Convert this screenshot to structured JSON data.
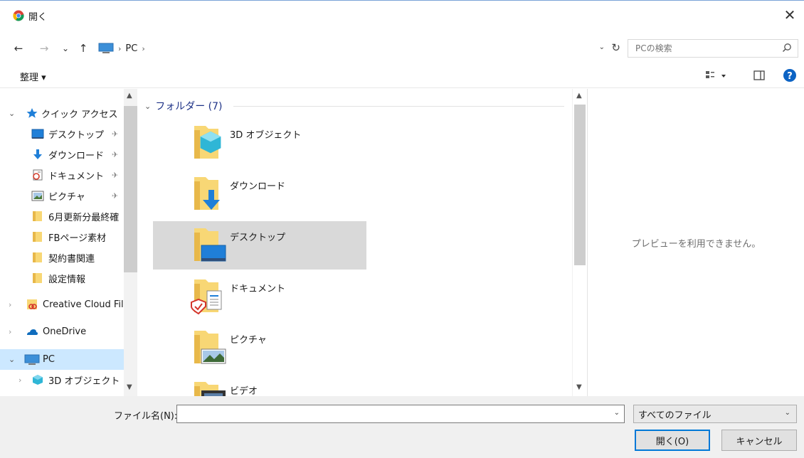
{
  "window": {
    "title": "開く",
    "close_glyph": "✕"
  },
  "nav": {
    "back": "←",
    "forward": "→",
    "recent": "⌄",
    "up": "↑",
    "address": {
      "segments": [
        "PC"
      ],
      "dropdown": "⌄",
      "refresh": "↻"
    },
    "search": {
      "placeholder": "PCの検索"
    }
  },
  "toolbar": {
    "organize": "整理 ▾"
  },
  "sidebar": {
    "items": [
      {
        "label": "クイック アクセス",
        "chevron": "⌄",
        "icon": "star-icon"
      },
      {
        "label": "デスクトップ",
        "icon": "desktop-icon",
        "pinned": true
      },
      {
        "label": "ダウンロード",
        "icon": "download-icon",
        "pinned": true
      },
      {
        "label": "ドキュメント",
        "icon": "document-icon",
        "pinned": true
      },
      {
        "label": "ピクチャ",
        "icon": "picture-icon",
        "pinned": true
      },
      {
        "label": "6月更新分最終確",
        "icon": "folder-icon"
      },
      {
        "label": "FBページ素材",
        "icon": "folder-icon"
      },
      {
        "label": "契約書関連",
        "icon": "folder-icon"
      },
      {
        "label": "設定情報",
        "icon": "folder-icon"
      },
      {
        "label": "Creative Cloud Files",
        "chevron": "›",
        "icon": "creative-cloud-icon"
      },
      {
        "label": "OneDrive",
        "chevron": "›",
        "icon": "onedrive-icon"
      },
      {
        "label": "PC",
        "chevron": "⌄",
        "icon": "pc-icon",
        "selected": true
      },
      {
        "label": "3D オブジェクト",
        "chevron": "›",
        "icon": "3d-objects-icon"
      }
    ],
    "pin_glyph": "✈"
  },
  "content": {
    "group_label": "フォルダー (7)",
    "group_chevron": "⌄",
    "folders": [
      {
        "label": "3D オブジェクト",
        "icon": "3d-objects-folder-icon"
      },
      {
        "label": "ダウンロード",
        "icon": "downloads-folder-icon"
      },
      {
        "label": "デスクトップ",
        "icon": "desktop-folder-icon",
        "selected": true
      },
      {
        "label": "ドキュメント",
        "icon": "documents-folder-icon"
      },
      {
        "label": "ピクチャ",
        "icon": "pictures-folder-icon"
      },
      {
        "label": "ビデオ",
        "icon": "videos-folder-icon"
      }
    ]
  },
  "preview": {
    "message": "プレビューを利用できません。"
  },
  "footer": {
    "filename_label": "ファイル名(N):",
    "filename_value": "",
    "filter_value": "すべてのファイル",
    "open_label": "開く(O)",
    "cancel_label": "キャンセル"
  },
  "colors": {
    "accent": "#0078d7",
    "selection": "#cce8ff",
    "folder": "#f8d775",
    "group_header": "#1e3287"
  }
}
